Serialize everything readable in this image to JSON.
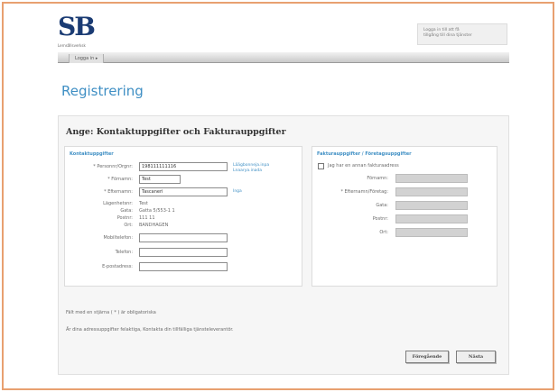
{
  "header": {
    "logo_text": "SB",
    "logo_subtitle": "Lernsållsverksk",
    "login_lines": [
      "Logga in till att få",
      "tillgång till dina tjänster"
    ]
  },
  "nav": {
    "tab_label": "Logga in ▸"
  },
  "page_title": "Registrering",
  "form": {
    "heading": "Ange: Kontaktuppgifter och Fakturauppgifter",
    "contact": {
      "heading": "Kontaktuppgifter",
      "personnummer_label": "* Personnr/Orgnr:",
      "personnummer_value": "198111111116",
      "personnummer_links": [
        "Läägbonneja.inpa",
        "Lnaarya.inada"
      ],
      "fornamn_label": "* Förnamn:",
      "fornamn_value": "Test",
      "efternamn_label": "* Efternamn:",
      "efternamn_value": "Tascaneri",
      "efternamn_link": "Inga",
      "lagenhet_label": "Lägenhetsnr:",
      "lagenhet_value": "Test",
      "gata_label": "Gata:",
      "gata_value": "Gatta 5/553-1 1",
      "postnr_label": "Postnr:",
      "postnr_value": "111 11",
      "ort_label": "Ort:",
      "ort_value": "BANDHAGEN",
      "mobil_label": "Mobiltelefon:",
      "mobil_value": "",
      "telefon_label": "Telefon:",
      "telefon_value": "",
      "epost_label": "E-postadress:",
      "epost_value": ""
    },
    "invoice": {
      "heading": "Fakturauppgifter / Företagsuppgifter",
      "checkbox_label": "Jag har en annan fakturaadress",
      "fornamn_label": "Förnamn:",
      "fornamn_value": "",
      "efternamn_label": "* Efternamn/Företag:",
      "efternamn_value": "",
      "gata_label": "Gata:",
      "gata_value": "",
      "postnr_label": "Postnr:",
      "postnr_value": "",
      "ort_label": "Ort:",
      "ort_value": ""
    },
    "required_note": "Fält med en stjärna ( * ) är obligatoriska",
    "address_note": "Är dina adressuppgifter felaktiga, Kontakta din tillfälliga tjänsteleverantör.",
    "back_label": "Föregående",
    "next_label": "Nästa"
  }
}
